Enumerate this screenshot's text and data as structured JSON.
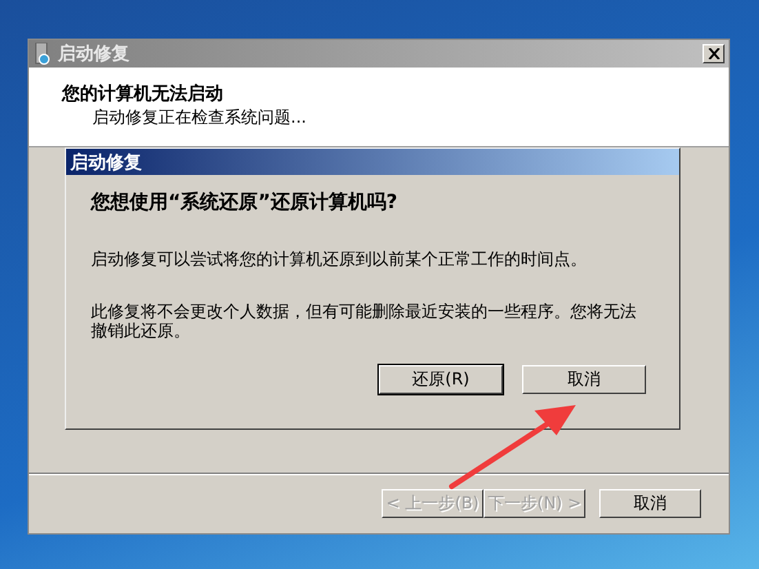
{
  "window": {
    "title": "启动修复",
    "heading": "您的计算机无法启动",
    "status": "启动修复正在检查系统问题..."
  },
  "dialog": {
    "title": "启动修复",
    "question": "您想使用“系统还原”还原计算机吗?",
    "paragraphs": [
      "启动修复可以尝试将您的计算机还原到以前某个正常工作的时间点。",
      "此修复将不会更改个人数据，但有可能删除最近安装的一些程序。您将无法撤销此还原。"
    ],
    "buttons": [
      {
        "label": "还原(R)",
        "default": true
      },
      {
        "label": "取消",
        "default": false
      }
    ]
  },
  "footer_buttons": [
    {
      "label": "< 上一步(B)",
      "disabled": true
    },
    {
      "label": "下一步(N) >",
      "disabled": true
    },
    {
      "label": "取消",
      "disabled": false
    }
  ]
}
